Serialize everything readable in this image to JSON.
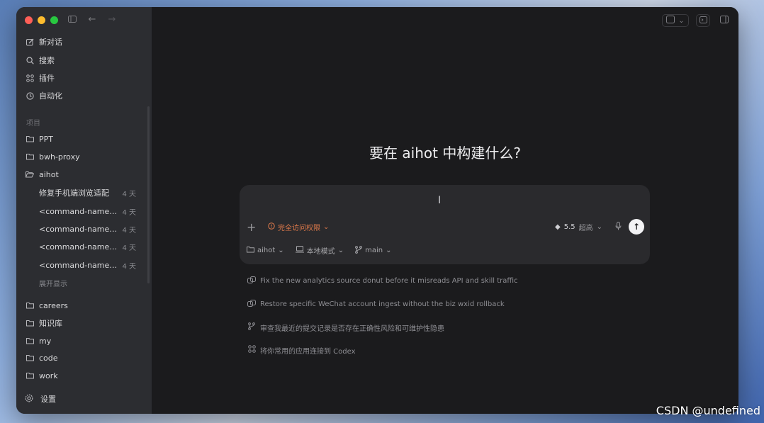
{
  "sidebar": {
    "nav": [
      {
        "label": "新对话",
        "icon": "edit-icon"
      },
      {
        "label": "搜索",
        "icon": "search-icon"
      },
      {
        "label": "插件",
        "icon": "grid-icon"
      },
      {
        "label": "自动化",
        "icon": "clock-icon"
      }
    ],
    "section_label": "项目",
    "projects_top": [
      {
        "label": "PPT",
        "icon": "folder-icon"
      },
      {
        "label": "bwh-proxy",
        "icon": "folder-icon"
      },
      {
        "label": "aihot",
        "icon": "folder-open-icon"
      }
    ],
    "threads": [
      {
        "title": "修复手机端浏览适配",
        "age": "4 天"
      },
      {
        "title": "<command-name>/...",
        "age": "4 天"
      },
      {
        "title": "<command-name>/...",
        "age": "4 天"
      },
      {
        "title": "<command-name>/...",
        "age": "4 天"
      },
      {
        "title": "<command-name>/...",
        "age": "4 天"
      }
    ],
    "show_more": "展开显示",
    "projects_bottom": [
      {
        "label": "careers",
        "icon": "folder-icon"
      },
      {
        "label": "知识库",
        "icon": "folder-icon"
      },
      {
        "label": "my",
        "icon": "folder-icon"
      },
      {
        "label": "code",
        "icon": "folder-icon"
      },
      {
        "label": "work",
        "icon": "folder-icon"
      }
    ],
    "settings_label": "设置"
  },
  "main": {
    "heading": "要在 aihot 中构建什么?",
    "composer": {
      "value": "",
      "permission_label": "完全访问权限",
      "model_version": "5.5",
      "model_level": "超高"
    },
    "meta": {
      "project": "aihot",
      "mode": "本地模式",
      "branch": "main"
    },
    "suggestions": [
      {
        "text": "Fix the new analytics source donut before it misreads API and skill traffic",
        "icon": "cloud-icon"
      },
      {
        "text": "Restore specific WeChat account ingest without the biz wxid rollback",
        "icon": "cloud-icon"
      },
      {
        "text": "审查我最近的提交记录是否存在正确性风险和可维护性隐患",
        "icon": "branch-icon"
      },
      {
        "text": "将你常用的应用连接到 Codex",
        "icon": "grid-icon"
      }
    ]
  },
  "watermark": "CSDN @undefined",
  "colors": {
    "accent_warning": "#e07a4b",
    "sidebar_bg": "#2c2d31",
    "main_bg": "#1b1b1d"
  }
}
